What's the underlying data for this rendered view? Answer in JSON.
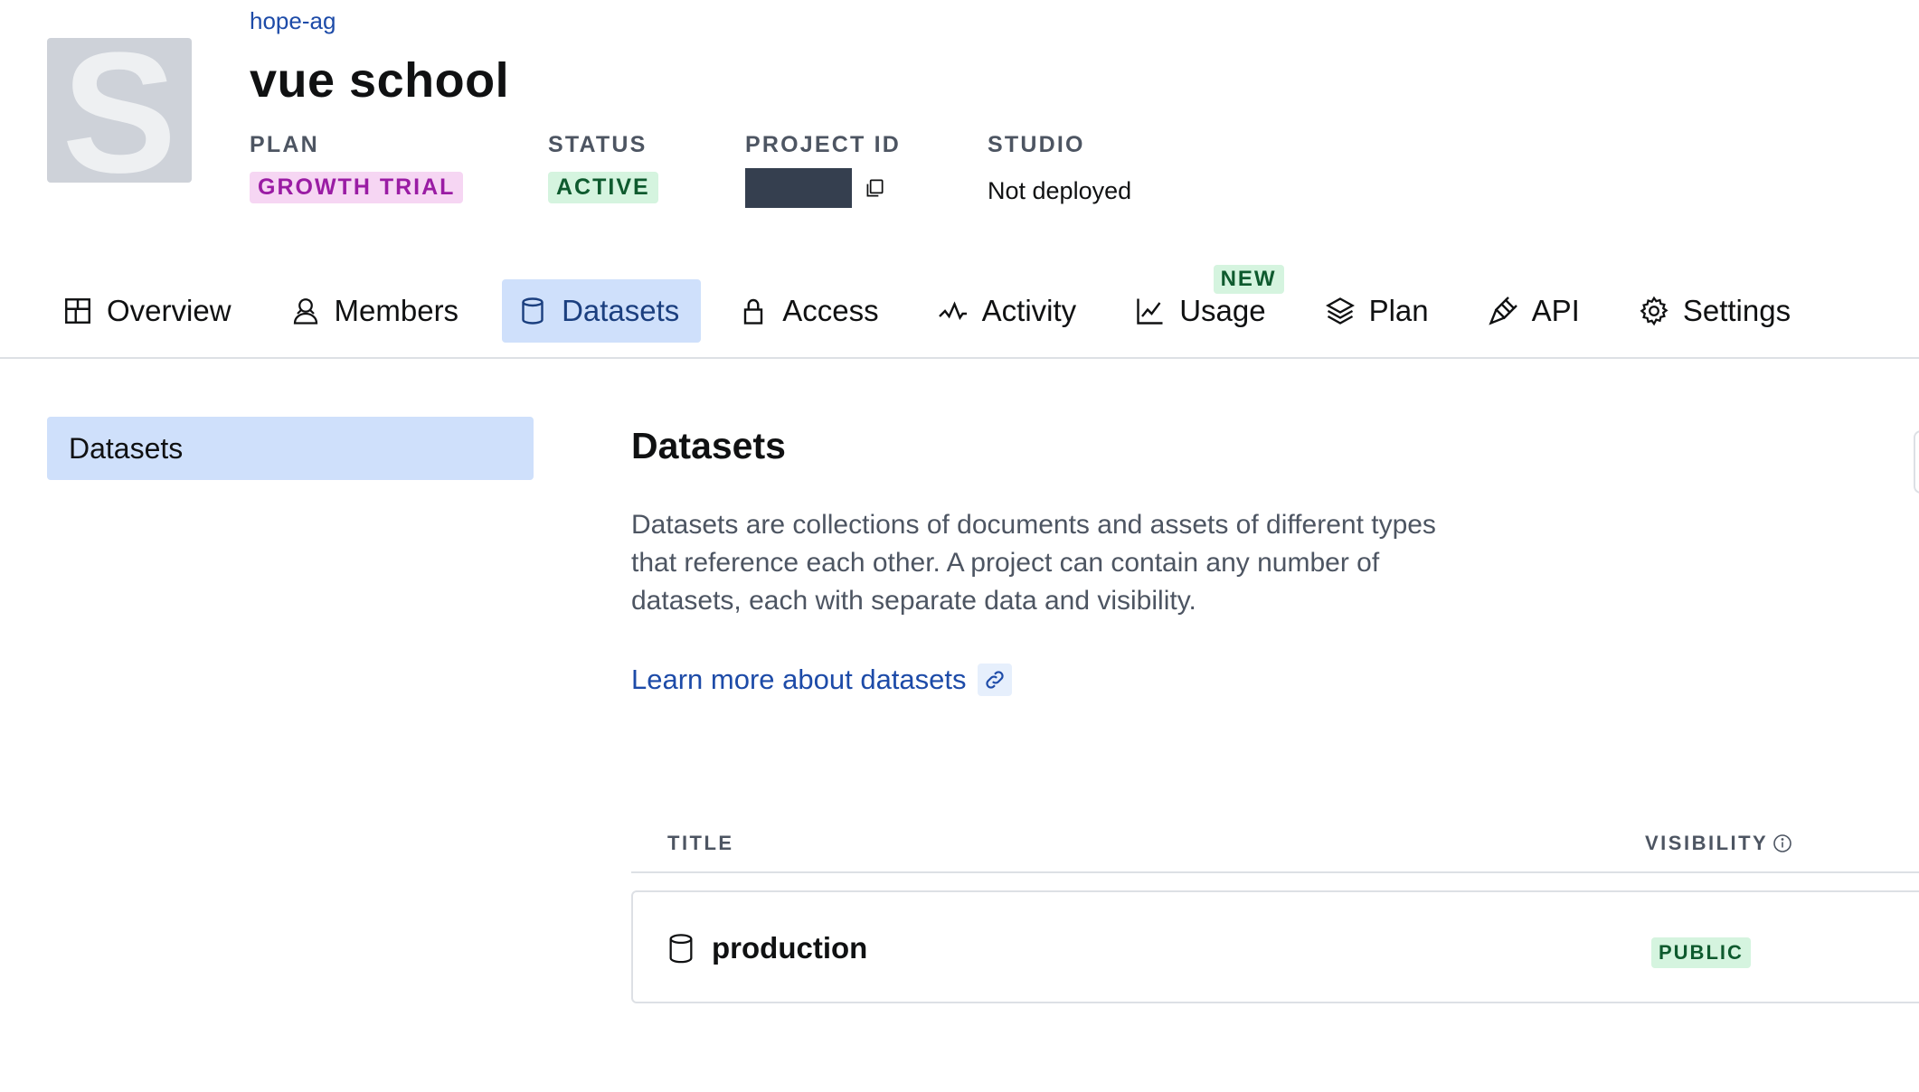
{
  "header": {
    "avatar_letter": "S",
    "org_link": "hope-ag",
    "project_title": "vue school",
    "plan": {
      "label": "PLAN",
      "value": "GROWTH TRIAL"
    },
    "status": {
      "label": "STATUS",
      "value": "ACTIVE"
    },
    "project_id": {
      "label": "PROJECT ID"
    },
    "studio": {
      "label": "STUDIO",
      "value": "Not deployed"
    }
  },
  "tabs": [
    {
      "label": "Overview",
      "icon": "overview-icon"
    },
    {
      "label": "Members",
      "icon": "members-icon"
    },
    {
      "label": "Datasets",
      "icon": "database-icon",
      "active": true
    },
    {
      "label": "Access",
      "icon": "lock-icon"
    },
    {
      "label": "Activity",
      "icon": "activity-icon"
    },
    {
      "label": "Usage",
      "icon": "chart-icon",
      "badge": "NEW"
    },
    {
      "label": "Plan",
      "icon": "layers-icon"
    },
    {
      "label": "API",
      "icon": "plug-icon"
    },
    {
      "label": "Settings",
      "icon": "gear-icon"
    }
  ],
  "sidebar": {
    "items": [
      {
        "label": "Datasets",
        "active": true
      }
    ]
  },
  "main": {
    "heading": "Datasets",
    "description": "Datasets are collections of documents and assets of different types that reference each other. A project can contain any number of datasets, each with separate data and visibility.",
    "learn_more": "Learn more about datasets",
    "table": {
      "columns": {
        "title": "TITLE",
        "visibility": "VISIBILITY"
      },
      "rows": [
        {
          "title": "production",
          "visibility": "PUBLIC"
        }
      ]
    }
  },
  "colors": {
    "accent": "#1d4ba8",
    "active_tab_bg": "#cfe0fb",
    "plan_badge_bg": "#f6d6f3",
    "status_badge_bg": "#d5f4df"
  }
}
